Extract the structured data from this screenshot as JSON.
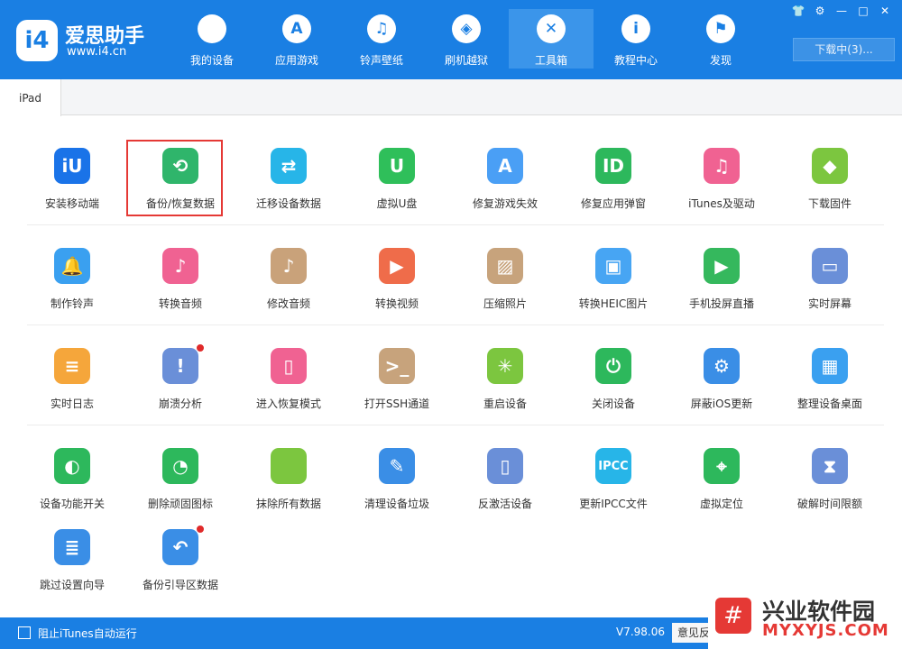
{
  "app": {
    "logo_mark": "i4",
    "name": "爱思助手",
    "url": "www.i4.cn"
  },
  "nav": [
    {
      "label": "我的设备",
      "icon": "apple-icon",
      "glyph": ""
    },
    {
      "label": "应用游戏",
      "icon": "appstore-icon",
      "glyph": "A"
    },
    {
      "label": "铃声壁纸",
      "icon": "music-icon",
      "glyph": "♫"
    },
    {
      "label": "刷机越狱",
      "icon": "dropbox-icon",
      "glyph": "◈"
    },
    {
      "label": "工具箱",
      "icon": "tools-icon",
      "glyph": "✕",
      "active": true
    },
    {
      "label": "教程中心",
      "icon": "info-icon",
      "glyph": "i"
    },
    {
      "label": "发现",
      "icon": "flag-icon",
      "glyph": "⚑"
    }
  ],
  "window_controls": [
    "👕",
    "⚙",
    "—",
    "□",
    "✕"
  ],
  "download_button": "下载中(3)...",
  "tab": "iPad",
  "tools": [
    {
      "label": "安装移动端",
      "color": "#1a73e8",
      "glyph": "iU"
    },
    {
      "label": "备份/恢复数据",
      "color": "#2fb56b",
      "glyph": "⟲"
    },
    {
      "label": "迁移设备数据",
      "color": "#27b5e8",
      "glyph": "⇄"
    },
    {
      "label": "虚拟U盘",
      "color": "#2fbf5a",
      "glyph": "U"
    },
    {
      "label": "修复游戏失效",
      "color": "#4a9ff5",
      "glyph": "A"
    },
    {
      "label": "修复应用弹窗",
      "color": "#2db85c",
      "glyph": "ID"
    },
    {
      "label": "iTunes及驱动",
      "color": "#f06292",
      "glyph": "♫"
    },
    {
      "label": "下载固件",
      "color": "#7cc63f",
      "glyph": "◆"
    },
    {
      "label": "制作铃声",
      "color": "#3aa0f0",
      "glyph": "🔔"
    },
    {
      "label": "转换音频",
      "color": "#f06292",
      "glyph": "♪"
    },
    {
      "label": "修改音频",
      "color": "#c9a27a",
      "glyph": "♪"
    },
    {
      "label": "转换视频",
      "color": "#ef6c4a",
      "glyph": "▶"
    },
    {
      "label": "压缩照片",
      "color": "#c7a37c",
      "glyph": "▨"
    },
    {
      "label": "转换HEIC图片",
      "color": "#47a5f3",
      "glyph": "▣"
    },
    {
      "label": "手机投屏直播",
      "color": "#35b85d",
      "glyph": "▶"
    },
    {
      "label": "实时屏幕",
      "color": "#6a8fd8",
      "glyph": "▭"
    },
    {
      "label": "实时日志",
      "color": "#f5a63b",
      "glyph": "≡"
    },
    {
      "label": "崩溃分析",
      "color": "#6a8fd8",
      "glyph": "!",
      "badge": true
    },
    {
      "label": "进入恢复模式",
      "color": "#f06292",
      "glyph": "▯"
    },
    {
      "label": "打开SSH通道",
      "color": "#c7a37c",
      "glyph": ">_"
    },
    {
      "label": "重启设备",
      "color": "#7cc63f",
      "glyph": "✳"
    },
    {
      "label": "关闭设备",
      "color": "#2db85c",
      "glyph": "⏻"
    },
    {
      "label": "屏蔽iOS更新",
      "color": "#3a8ee6",
      "glyph": "⚙"
    },
    {
      "label": "整理设备桌面",
      "color": "#3aa0f0",
      "glyph": "▦"
    },
    {
      "label": "设备功能开关",
      "color": "#2db85c",
      "glyph": "◐"
    },
    {
      "label": "删除顽固图标",
      "color": "#2db85c",
      "glyph": "◔"
    },
    {
      "label": "抹除所有数据",
      "color": "#7cc63f",
      "glyph": ""
    },
    {
      "label": "清理设备垃圾",
      "color": "#3a8ee6",
      "glyph": "✎"
    },
    {
      "label": "反激活设备",
      "color": "#6a8fd8",
      "glyph": "▯"
    },
    {
      "label": "更新IPCC文件",
      "color": "#27b5e8",
      "glyph": "IPCC"
    },
    {
      "label": "虚拟定位",
      "color": "#2db85c",
      "glyph": "⌖"
    },
    {
      "label": "破解时间限额",
      "color": "#6a8fd8",
      "glyph": "⧗"
    },
    {
      "label": "跳过设置向导",
      "color": "#3a8ee6",
      "glyph": "≣"
    },
    {
      "label": "备份引导区数据",
      "color": "#3a8ee6",
      "glyph": "↶",
      "badge": true
    }
  ],
  "status": {
    "checkbox_label": "阻止iTunes自动运行",
    "version": "V7.98.06",
    "feedback": "意见反馈"
  },
  "watermark": {
    "logo": "#",
    "title": "兴业软件园",
    "sub": "MYXYJS.COM"
  }
}
